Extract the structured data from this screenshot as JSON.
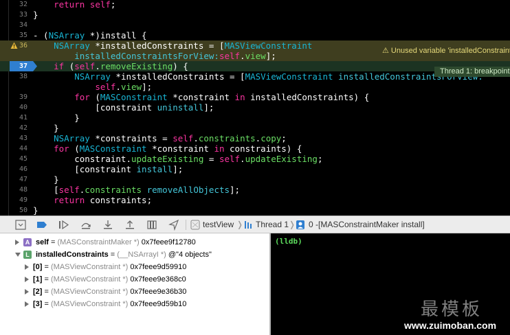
{
  "editor": {
    "warning_text": "Unused variable 'installedConstraint",
    "breakpoint_text": "Thread 1: breakpoint",
    "lines": [
      {
        "num": "32",
        "segs": [
          {
            "t": "    "
          },
          {
            "t": "return",
            "c": "kw"
          },
          {
            "t": " "
          },
          {
            "t": "self",
            "c": "kw"
          },
          {
            "t": ";"
          }
        ]
      },
      {
        "num": "33",
        "segs": [
          {
            "t": "}"
          }
        ]
      },
      {
        "num": "34",
        "segs": [
          {
            "t": ""
          }
        ]
      },
      {
        "num": "35",
        "segs": [
          {
            "t": "- ("
          },
          {
            "t": "NSArray",
            "c": "ty"
          },
          {
            "t": " *)install {"
          }
        ]
      },
      {
        "num": "36",
        "segs": [
          {
            "t": "    "
          },
          {
            "t": "NSArray",
            "c": "ty"
          },
          {
            "t": " *installedConstraints = ["
          },
          {
            "t": "MASViewConstraint",
            "c": "ty"
          }
        ]
      },
      {
        "num": "",
        "segs": [
          {
            "t": "        "
          },
          {
            "t": "installedConstraintsForView:",
            "c": "fn"
          },
          {
            "t": "self",
            "c": "kw"
          },
          {
            "t": "."
          },
          {
            "t": "view",
            "c": "pr"
          },
          {
            "t": "];"
          }
        ]
      },
      {
        "num": "37",
        "segs": [
          {
            "t": "    "
          },
          {
            "t": "if",
            "c": "kw"
          },
          {
            "t": " ("
          },
          {
            "t": "self",
            "c": "kw"
          },
          {
            "t": "."
          },
          {
            "t": "removeExisting",
            "c": "pr"
          },
          {
            "t": ") {"
          }
        ]
      },
      {
        "num": "38",
        "segs": [
          {
            "t": "        "
          },
          {
            "t": "NSArray",
            "c": "ty"
          },
          {
            "t": " *installedConstraints = ["
          },
          {
            "t": "MASViewConstraint",
            "c": "ty"
          },
          {
            "t": " "
          },
          {
            "t": "installedConstraintsForView:",
            "c": "fn"
          }
        ]
      },
      {
        "num": "",
        "segs": [
          {
            "t": "            "
          },
          {
            "t": "self",
            "c": "kw"
          },
          {
            "t": "."
          },
          {
            "t": "view",
            "c": "pr"
          },
          {
            "t": "];"
          }
        ]
      },
      {
        "num": "39",
        "segs": [
          {
            "t": "        "
          },
          {
            "t": "for",
            "c": "kw"
          },
          {
            "t": " ("
          },
          {
            "t": "MASConstraint",
            "c": "ty"
          },
          {
            "t": " *constraint "
          },
          {
            "t": "in",
            "c": "kw"
          },
          {
            "t": " installedConstraints) {"
          }
        ]
      },
      {
        "num": "40",
        "segs": [
          {
            "t": "            [constraint "
          },
          {
            "t": "uninstall",
            "c": "fn"
          },
          {
            "t": "];"
          }
        ]
      },
      {
        "num": "41",
        "segs": [
          {
            "t": "        }"
          }
        ]
      },
      {
        "num": "42",
        "segs": [
          {
            "t": "    }"
          }
        ]
      },
      {
        "num": "43",
        "segs": [
          {
            "t": "    "
          },
          {
            "t": "NSArray",
            "c": "ty"
          },
          {
            "t": " *constraints = "
          },
          {
            "t": "self",
            "c": "kw"
          },
          {
            "t": "."
          },
          {
            "t": "constraints",
            "c": "pr"
          },
          {
            "t": "."
          },
          {
            "t": "copy",
            "c": "pr"
          },
          {
            "t": ";"
          }
        ]
      },
      {
        "num": "44",
        "segs": [
          {
            "t": "    "
          },
          {
            "t": "for",
            "c": "kw"
          },
          {
            "t": " ("
          },
          {
            "t": "MASConstraint",
            "c": "ty"
          },
          {
            "t": " *constraint "
          },
          {
            "t": "in",
            "c": "kw"
          },
          {
            "t": " constraints) {"
          }
        ]
      },
      {
        "num": "45",
        "segs": [
          {
            "t": "        constraint."
          },
          {
            "t": "updateExisting",
            "c": "pr"
          },
          {
            "t": " = "
          },
          {
            "t": "self",
            "c": "kw"
          },
          {
            "t": "."
          },
          {
            "t": "updateExisting",
            "c": "pr"
          },
          {
            "t": ";"
          }
        ]
      },
      {
        "num": "46",
        "segs": [
          {
            "t": "        [constraint "
          },
          {
            "t": "install",
            "c": "fn"
          },
          {
            "t": "];"
          }
        ]
      },
      {
        "num": "47",
        "segs": [
          {
            "t": "    }"
          }
        ]
      },
      {
        "num": "48",
        "segs": [
          {
            "t": "    ["
          },
          {
            "t": "self",
            "c": "kw"
          },
          {
            "t": "."
          },
          {
            "t": "constraints",
            "c": "pr"
          },
          {
            "t": " "
          },
          {
            "t": "removeAllObjects",
            "c": "fn"
          },
          {
            "t": "];"
          }
        ]
      },
      {
        "num": "49",
        "segs": [
          {
            "t": "    "
          },
          {
            "t": "return",
            "c": "kw"
          },
          {
            "t": " constraints;"
          }
        ]
      },
      {
        "num": "50",
        "segs": [
          {
            "t": "}"
          }
        ]
      }
    ]
  },
  "toolbar": {
    "scheme": "testView",
    "thread": "Thread 1",
    "frame": "0 -[MASConstraintMaker install]"
  },
  "variables": [
    {
      "name": "self",
      "eq": " = ",
      "type": "(MASConstraintMaker *)",
      "value": " 0x7feee9f12780",
      "icon": "A",
      "icon_color": "#8c6fc4",
      "expanded": false,
      "indent": 0
    },
    {
      "name": "installedConstraints",
      "eq": " = ",
      "type": "(__NSArrayI *)",
      "value": " @\"4 objects\"",
      "icon": "L",
      "icon_color": "#5aa36a",
      "expanded": true,
      "indent": 0
    },
    {
      "name": "[0]",
      "eq": " = ",
      "type": "(MASViewConstraint *)",
      "value": " 0x7feee9d59910",
      "indent": 1
    },
    {
      "name": "[1]",
      "eq": " = ",
      "type": "(MASViewConstraint *)",
      "value": " 0x7feee9e368c0",
      "indent": 1
    },
    {
      "name": "[2]",
      "eq": " = ",
      "type": "(MASViewConstraint *)",
      "value": " 0x7feee9e36b30",
      "indent": 1
    },
    {
      "name": "[3]",
      "eq": " = ",
      "type": "(MASViewConstraint *)",
      "value": " 0x7feee9d59b10",
      "indent": 1
    }
  ],
  "console": {
    "prompt": "(lldb)"
  },
  "watermark": {
    "chars": "最模板",
    "url": "www.zuimoban.com"
  },
  "colors": {
    "keyword": "#fa35a1",
    "type": "#19b5d4",
    "property": "#6bdf65",
    "warning_bg": "#3f3e1f",
    "breakpoint": "#2f7fd0"
  }
}
